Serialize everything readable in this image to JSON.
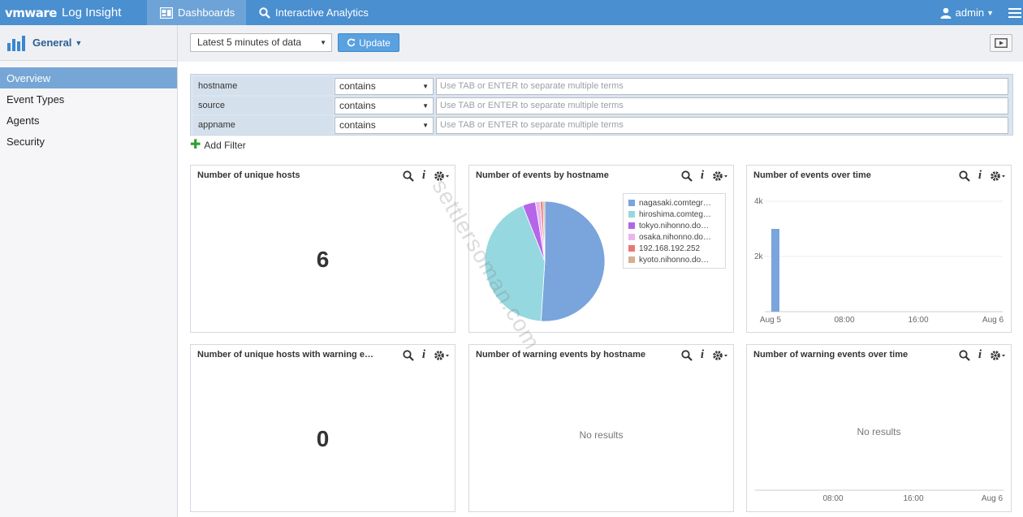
{
  "topbar": {
    "brand_vm": "vmware",
    "brand_product": "Log Insight",
    "tabs": [
      {
        "label": "Dashboards",
        "icon": "dashboard-icon"
      },
      {
        "label": "Interactive Analytics",
        "icon": "search-icon"
      }
    ],
    "user": "admin",
    "color": "#4a8fd0"
  },
  "sidebar": {
    "header": "General",
    "items": [
      {
        "label": "Overview",
        "active": true
      },
      {
        "label": "Event Types"
      },
      {
        "label": "Agents"
      },
      {
        "label": "Security"
      }
    ]
  },
  "toolbar": {
    "time_range": "Latest 5 minutes of data",
    "update_label": "Update"
  },
  "filters": {
    "rows": [
      {
        "field": "hostname",
        "operator": "contains",
        "placeholder": "Use TAB or ENTER to separate multiple terms"
      },
      {
        "field": "source",
        "operator": "contains",
        "placeholder": "Use TAB or ENTER to separate multiple terms"
      },
      {
        "field": "appname",
        "operator": "contains",
        "placeholder": "Use TAB or ENTER to separate multiple terms"
      }
    ],
    "add_label": "Add Filter"
  },
  "widgets": [
    {
      "title": "Number of unique hosts",
      "value": "6"
    },
    {
      "title": "Number of events by hostname"
    },
    {
      "title": "Number of events over time"
    },
    {
      "title": "Number of unique hosts with warning e…",
      "value": "0"
    },
    {
      "title": "Number of warning events by hostname",
      "no_results": "No results"
    },
    {
      "title": "Number of warning events over time",
      "no_results": "No results"
    }
  ],
  "chart_data": [
    {
      "type": "pie",
      "legend": [
        "nagasaki.comtegr…",
        "hiroshima.comteg…",
        "tokyo.nihonno.do…",
        "osaka.nihonno.do…",
        "192.168.192.252",
        "kyoto.nihonno.do…"
      ],
      "values": [
        51,
        43,
        3.5,
        1.3,
        0.7,
        0.5
      ],
      "colors": [
        "#7aa4dc",
        "#95d8e0",
        "#b565e8",
        "#ecb5ec",
        "#e87878",
        "#d4b090"
      ]
    },
    {
      "type": "bar",
      "y_ticks": [
        "4k",
        "2k"
      ],
      "x_ticks": [
        "Aug 5",
        "08:00",
        "16:00",
        "Aug 6"
      ],
      "ylim": [
        0,
        4000
      ],
      "bars": [
        {
          "x": "Aug 5",
          "value": 3000
        }
      ],
      "color": "#7aa4dc"
    },
    {
      "type": "line",
      "x_ticks": [
        "08:00",
        "16:00",
        "Aug 6"
      ],
      "no_results": "No results"
    }
  ],
  "watermark": "settlersoman.com"
}
